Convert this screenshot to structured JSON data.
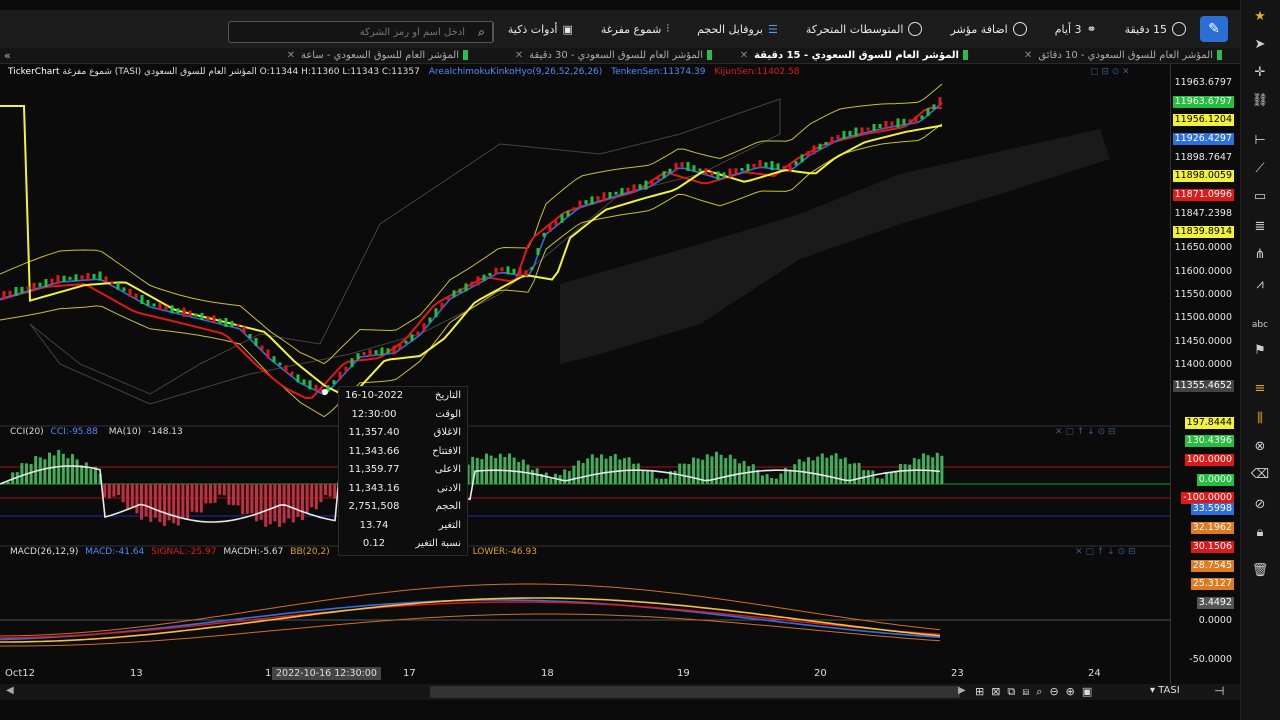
{
  "toolbar": {
    "interval": "15 دقيقة",
    "days": "3 أيام",
    "add_indicator": "اضافة مؤشر",
    "moving_averages": "المتوسطات المتحركة",
    "volume_profile": "بروفايل الحجم",
    "hollow_candles": "شموع مفرغة",
    "smart_tools": "أدوات ذكية",
    "search_placeholder": "ادخل اسم أو رمز الشركة"
  },
  "tabs": [
    {
      "label": "المؤشر العام للسوق السعودي - 10 دقائق",
      "active": false
    },
    {
      "label": "المؤشر العام للسوق السعودي - 15 دقيقة",
      "active": true
    },
    {
      "label": "المؤشر العام للسوق السعودي - 30 دقيقة",
      "active": false
    },
    {
      "label": "المؤشر العام للسوق السعودي - ساعة",
      "active": false
    }
  ],
  "main_header": {
    "brand": "TickerChart",
    "title": "المؤشر العام للسوق السعودي (TASI) شموع مفرغة",
    "ohlc": "O:11344  H:11360  L:11343  C:11357",
    "ichimoku": "AreaIchimokuKinkoHyo(9,26,52,26,26)",
    "tenkan": "TenkenSen:11374.39",
    "kijun": "KijunSen:11402.58"
  },
  "price_labels": [
    {
      "text": "11963.6797",
      "bg": "",
      "color": "#e8e8e8"
    },
    {
      "text": "11963.6797",
      "bg": "#22c03c",
      "color": "#ffffff"
    },
    {
      "text": "11956.1204",
      "bg": "#f2f23a",
      "color": "#000000"
    },
    {
      "text": "11926.4297",
      "bg": "#2e6fe0",
      "color": "#ffffff"
    },
    {
      "text": "11898.7647",
      "bg": "",
      "color": "#e8e8e8"
    },
    {
      "text": "11898.0059",
      "bg": "#f2f23a",
      "color": "#000000"
    },
    {
      "text": "11871.0996",
      "bg": "#e01818",
      "color": "#ffffff"
    },
    {
      "text": "11847.2398",
      "bg": "",
      "color": "#e8e8e8"
    },
    {
      "text": "11839.8914",
      "bg": "#f2f23a",
      "color": "#000000"
    },
    {
      "text": "11650.0000",
      "bg": "",
      "color": "#e8e8e8"
    },
    {
      "text": "11600.0000",
      "bg": "",
      "color": "#e8e8e8"
    },
    {
      "text": "11550.0000",
      "bg": "",
      "color": "#e8e8e8"
    },
    {
      "text": "11500.0000",
      "bg": "",
      "color": "#e8e8e8"
    },
    {
      "text": "11450.0000",
      "bg": "",
      "color": "#e8e8e8"
    },
    {
      "text": "11400.0000",
      "bg": "",
      "color": "#e8e8e8"
    },
    {
      "text": "11355.4652",
      "bg": "#444444",
      "color": "#ffffff"
    }
  ],
  "cci_header": {
    "name": "CCI(20)",
    "cci": "CCI:-95.88",
    "ma": "MA(10)",
    "ma_val": "-148.13"
  },
  "cci_labels": [
    {
      "text": "197.8444",
      "bg": "#f2f23a",
      "color": "#000000"
    },
    {
      "text": "130.4396",
      "bg": "#22c03c",
      "color": "#ffffff"
    },
    {
      "text": "100.0000",
      "bg": "#e01818",
      "color": "#ffffff"
    },
    {
      "text": "0.0000",
      "bg": "#22c03c",
      "color": "#ffffff"
    },
    {
      "text": "-100.0000",
      "bg": "#e01818",
      "color": "#ffffff"
    },
    {
      "text": "33.5998",
      "bg": "#2e6fe0",
      "color": "#ffffff"
    }
  ],
  "macd_header": {
    "name": "MACD(26,12,9)",
    "macd": "MACD:-41.64",
    "signal": "SIGNAL:-25.97",
    "macdh": "MACDH:-5.67",
    "bb": "BB(20,2)",
    "lower": "LOWER:-46.93"
  },
  "macd_labels": [
    {
      "text": "32.1962",
      "bg": "#e07a1e",
      "color": "#ffffff"
    },
    {
      "text": "30.1506",
      "bg": "#e01818",
      "color": "#ffffff"
    },
    {
      "text": "28.7545",
      "bg": "#e07a1e",
      "color": "#ffffff"
    },
    {
      "text": "25.3127",
      "bg": "#e07a1e",
      "color": "#ffffff"
    },
    {
      "text": "3.4492",
      "bg": "#555555",
      "color": "#ffffff"
    },
    {
      "text": "0.0000",
      "bg": "",
      "color": "#e8e8e8"
    },
    {
      "text": "-50.0000",
      "bg": "",
      "color": "#e8e8e8"
    }
  ],
  "tooltip": [
    {
      "k": "التاريخ",
      "v": "16-10-2022"
    },
    {
      "k": "الوقت",
      "v": "12:30:00"
    },
    {
      "k": "الاغلاق",
      "v": "11,357.40"
    },
    {
      "k": "الافتتاح",
      "v": "11,343.66"
    },
    {
      "k": "الاعلى",
      "v": "11,359.77"
    },
    {
      "k": "الادنى",
      "v": "11,343.16"
    },
    {
      "k": "الحجم",
      "v": "2,751,508"
    },
    {
      "k": "التغير",
      "v": "13.74"
    },
    {
      "k": "نسبة التغير",
      "v": "0.12"
    }
  ],
  "x_labels": [
    "Oct12",
    "13",
    "16",
    "17",
    "18",
    "19",
    "20",
    "23",
    "24"
  ],
  "cursor_time": "2022-10-16 12:30:00",
  "symbol": "TASI",
  "colors": {
    "up": "#22c03c",
    "down": "#e01818",
    "tenkan": "#2e6fe0",
    "kijun": "#e01818",
    "ma": "#f2f23a"
  }
}
